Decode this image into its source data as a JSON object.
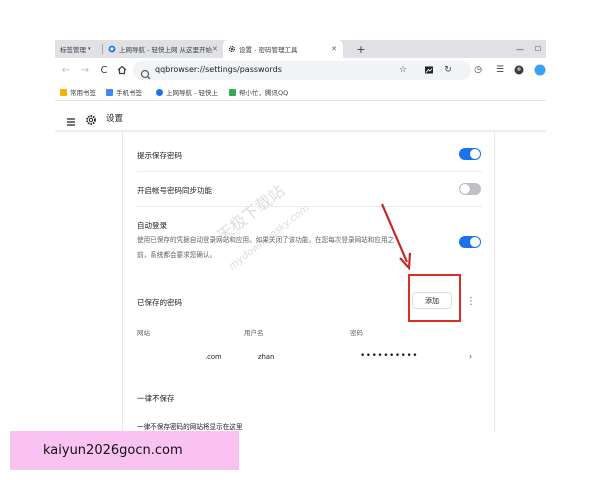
{
  "tabs": [
    {
      "label": "标签管理",
      "icon": "tab-list-icon"
    },
    {
      "label": "上网导航 - 轻快上网 从这里开始",
      "icon": "qq-browser-icon"
    },
    {
      "label": "设置 - 密码管理工具",
      "icon": "gear-icon",
      "active": true
    }
  ],
  "new_tab_label": "+",
  "window_controls": {
    "minimize": "—",
    "maximize": "☐"
  },
  "address_bar": {
    "url": "qqbrowser://settings/passwords"
  },
  "bookmarks": [
    {
      "label": "常用书签",
      "color": "#f4b400"
    },
    {
      "label": "手机书签",
      "color": "#4285f4"
    },
    {
      "label": "上网导航 - 轻快上",
      "color": "#4285f4"
    },
    {
      "label": "帮小忙，腾讯QQ",
      "color": "#34a853"
    }
  ],
  "settings": {
    "title": "设置",
    "offer_to_save": {
      "label": "提示保存密码",
      "enabled": true
    },
    "sync_passwords": {
      "label": "开启帐号密码同步功能",
      "enabled": false
    },
    "auto_signin": {
      "label": "自动登录",
      "desc_line1": "使用已保存的凭据自动登录网站和应用。如果关闭了该功能，在您每次登录网站和应用之",
      "desc_line2": "前，系统都会要求您确认。",
      "enabled": true
    },
    "saved_passwords": {
      "heading": "已保存的密码",
      "add_button": "添加",
      "more": "⋮",
      "columns": [
        "网站",
        "用户名",
        "密码"
      ],
      "rows": [
        {
          "site": ".com",
          "username": "zhan",
          "password": "••••••••••"
        }
      ]
    },
    "never_saved": {
      "heading": "一律不保存",
      "desc": "一律不保存密码的网站将显示在这里"
    }
  },
  "watermark": {
    "line1": "天极下载站",
    "line2": "mydown.yesky.com"
  },
  "banner": {
    "text": "kaiyun2026gocn.com"
  },
  "colors": {
    "toggle_on": "#1a73e8",
    "toggle_off": "#bdc1c6",
    "highlight": "#d93025",
    "banner_bg": "#f9c2f0"
  }
}
